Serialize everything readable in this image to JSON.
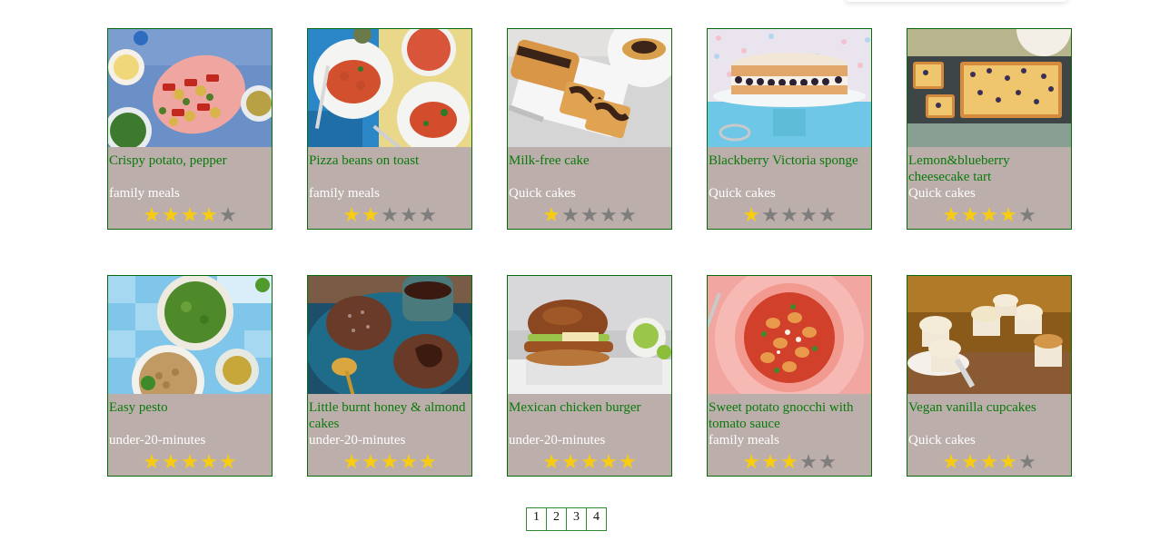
{
  "recipes": [
    {
      "title": "Crispy potato, pepper",
      "category": "family meals",
      "rating": 4,
      "image": "potato-pepper-skewers-photo"
    },
    {
      "title": "Pizza beans on toast",
      "category": "family meals",
      "rating": 2,
      "image": "pizza-beans-toast-photo"
    },
    {
      "title": "Milk-free cake",
      "category": "Quick cakes",
      "rating": 1,
      "image": "marble-loaf-cake-photo"
    },
    {
      "title": "Blackberry Victoria sponge",
      "category": "Quick cakes",
      "rating": 1,
      "image": "victoria-sponge-photo"
    },
    {
      "title": "Lemon&blueberry cheesecake tart",
      "category": "Quick cakes",
      "rating": 4,
      "image": "cheesecake-tart-photo"
    },
    {
      "title": "Easy pesto",
      "category": "under-20-minutes",
      "rating": 5,
      "image": "pesto-bowl-photo"
    },
    {
      "title": "Little burnt honey & almond cakes",
      "category": "under-20-minutes",
      "rating": 5,
      "image": "honey-almond-cakes-photo"
    },
    {
      "title": "Mexican chicken burger",
      "category": "under-20-minutes",
      "rating": 5,
      "image": "chicken-burger-photo"
    },
    {
      "title": "Sweet potato gnocchi with tomato sauce",
      "category": "family meals",
      "rating": 3,
      "image": "gnocchi-tomato-photo"
    },
    {
      "title": "Vegan vanilla cupcakes",
      "category": "Quick cakes",
      "rating": 4,
      "image": "vanilla-cupcakes-photo"
    }
  ],
  "rating_max": 5,
  "colors": {
    "title": "#0b7a0b",
    "card_bg": "#bbaeab",
    "star_on": "#f7cc12",
    "star_off": "#7e7e7e",
    "border": "#0a6b0a"
  },
  "pagination": {
    "pages": [
      "1",
      "2",
      "3",
      "4"
    ]
  }
}
